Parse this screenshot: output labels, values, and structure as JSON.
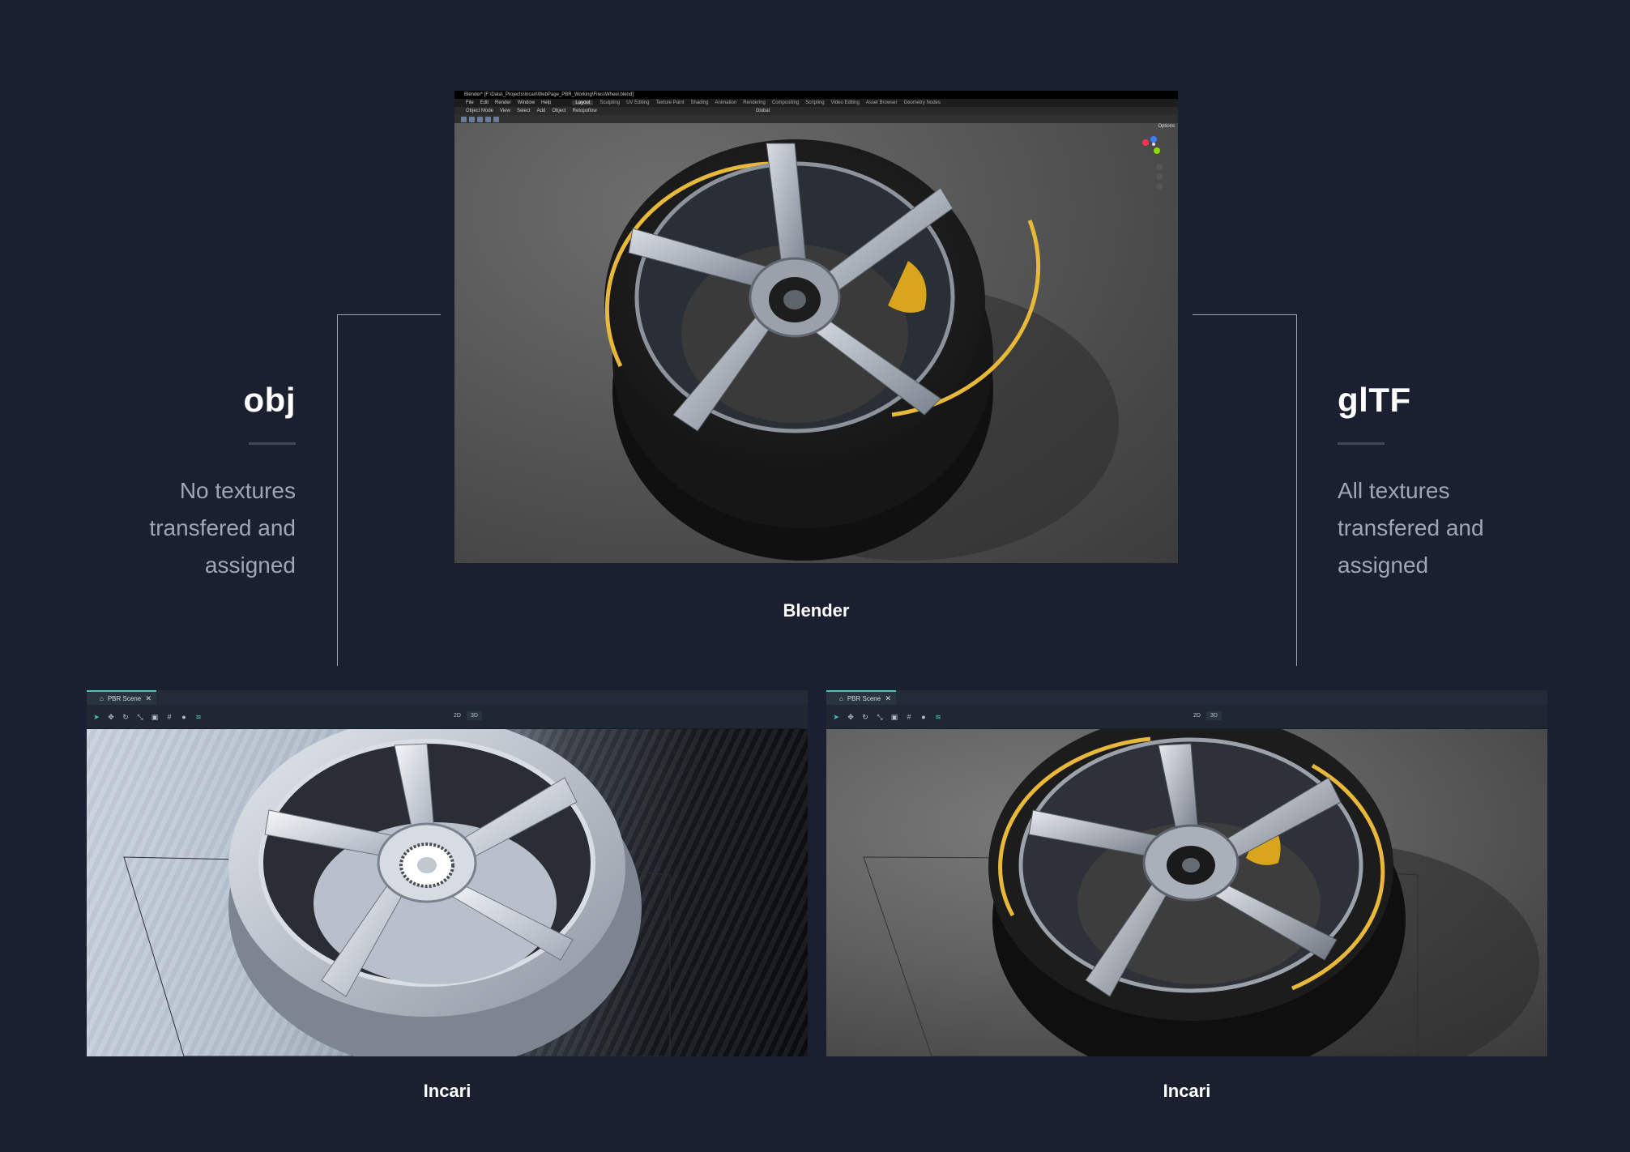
{
  "left_format": {
    "title": "obj",
    "desc_lines": [
      "No textures",
      "transfered and",
      "assigned"
    ]
  },
  "right_format": {
    "title": "glTF",
    "desc_lines": [
      "All textures",
      "transfered and",
      "assigned"
    ]
  },
  "captions": {
    "blender": "Blender",
    "incari_left": "Incari",
    "incari_right": "Incari"
  },
  "blender": {
    "title_bar": "Blender* [F:\\Data\\_Projects\\Incari\\WebPage_PBR_Working\\Files\\Wheel.blend]",
    "menus": [
      "File",
      "Edit",
      "Render",
      "Window",
      "Help"
    ],
    "workspaces": [
      "Layout",
      "Sculpting",
      "UV Editing",
      "Texture Paint",
      "Shading",
      "Animation",
      "Rendering",
      "Compositing",
      "Scripting",
      "Video Editing",
      "Asset Browser",
      "Geometry Nodes"
    ],
    "active_workspace": "Layout",
    "header_items": [
      "Object Mode",
      "View",
      "Select",
      "Add",
      "Object",
      "Retopoflow"
    ],
    "transform_orientation": "Global",
    "options_label": "Options"
  },
  "incari": {
    "tab_label": "PBR Scene",
    "close_glyph": "✕",
    "view_modes": [
      "2D",
      "3D"
    ],
    "active_mode": "3D"
  },
  "colors": {
    "background": "#1a2030",
    "accent": "#4ac6bd",
    "tyre_stripe": "#e8b83a",
    "caliper": "#d9a51f"
  },
  "icons": [
    "cursor-icon",
    "move-icon",
    "rotate-icon",
    "scale-icon",
    "frame-icon",
    "grid-icon",
    "light-icon",
    "wifi-icon",
    "scene-icon",
    "close-icon"
  ]
}
